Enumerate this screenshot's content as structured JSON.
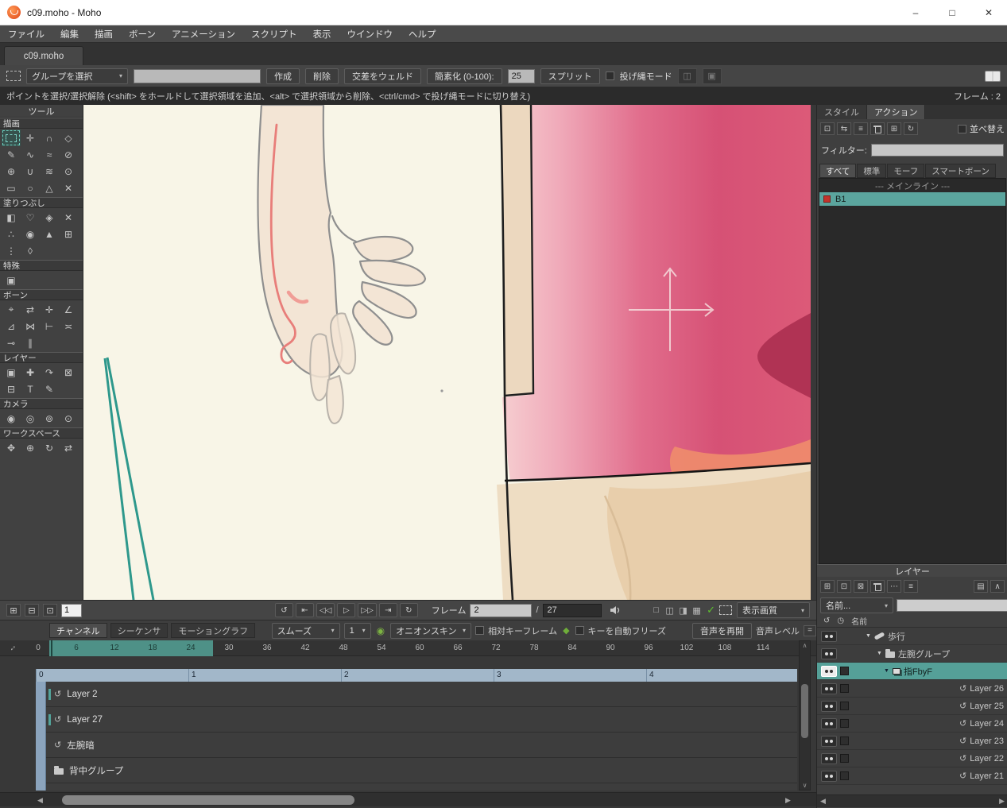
{
  "window": {
    "title": "c09.moho - Moho",
    "minimize": "–",
    "maximize": "□",
    "close": "✕"
  },
  "menu": {
    "items": [
      "ファイル",
      "編集",
      "描画",
      "ボーン",
      "アニメーション",
      "スクリプト",
      "表示",
      "ウインドウ",
      "ヘルプ"
    ]
  },
  "doc_tab": {
    "label": "c09.moho"
  },
  "toolbar": {
    "group_select": {
      "label": "グループを選択"
    },
    "search_value": "",
    "create": "作成",
    "delete": "削除",
    "weld": "交差をウェルド",
    "simplify": "簡素化 (0-100):",
    "simplify_value": "25",
    "split": "スプリット",
    "lasso": "投げ縄モード"
  },
  "hint": {
    "text": "ポイントを選択/選択解除 (<shift> をホールドして選択領域を追加、<alt> で選択領域から削除、<ctrl/cmd> で投げ縄モードに切り替え)",
    "frame": "フレーム : 2"
  },
  "tool_panel": {
    "title": "ツール",
    "draw": {
      "label": "描画",
      "tools": [
        {
          "name": "select-points",
          "marquee": true,
          "selected": true
        },
        {
          "name": "translate-points",
          "glyph": "✛"
        },
        {
          "name": "magnet",
          "glyph": "∩"
        },
        {
          "name": "perspective-points",
          "glyph": "◇"
        },
        {
          "name": "add-point",
          "glyph": "✎"
        },
        {
          "name": "freehand",
          "glyph": "∿"
        },
        {
          "name": "blob-brush",
          "glyph": "≈"
        },
        {
          "name": "delete-edge",
          "glyph": "⊘"
        },
        {
          "name": "draw-shape",
          "glyph": "⊕"
        },
        {
          "name": "curvature",
          "glyph": "∪"
        },
        {
          "name": "noise",
          "glyph": "≋"
        },
        {
          "name": "magnet-radius",
          "glyph": "⊙"
        },
        {
          "name": "rectangle",
          "glyph": "▭"
        },
        {
          "name": "oval",
          "glyph": "○"
        },
        {
          "name": "triangle",
          "glyph": "△"
        },
        {
          "name": "eraser",
          "glyph": "✕"
        }
      ]
    },
    "fill": {
      "label": "塗りつぶし",
      "tools": [
        {
          "name": "select-shape",
          "glyph": "◧"
        },
        {
          "name": "create-shape",
          "glyph": "♡"
        },
        {
          "name": "paint-bucket",
          "glyph": "◈"
        },
        {
          "name": "delete-shape",
          "glyph": "✕"
        },
        {
          "name": "stroke-exposure",
          "glyph": "∴"
        },
        {
          "name": "eyedropper",
          "glyph": "◉"
        },
        {
          "name": "line-width",
          "glyph": "▲"
        },
        {
          "name": "hide-edge",
          "glyph": "⊞"
        },
        {
          "name": "curve-profile",
          "glyph": "⋮"
        },
        {
          "name": "stroke-width",
          "glyph": "◊"
        }
      ]
    },
    "special": {
      "label": "特殊",
      "tools": [
        {
          "name": "insert-text",
          "glyph": "▣"
        }
      ]
    },
    "bone": {
      "label": "ボーン",
      "tools": [
        {
          "name": "select-bone",
          "glyph": "⌖"
        },
        {
          "name": "translate-bone",
          "glyph": "⇄"
        },
        {
          "name": "add-bone",
          "glyph": "✛"
        },
        {
          "name": "rotate-bone",
          "glyph": "∠"
        },
        {
          "name": "scale-bone",
          "glyph": "⊿"
        },
        {
          "name": "reparent-bone",
          "glyph": "⋈"
        },
        {
          "name": "bone-strength",
          "glyph": "⊢"
        },
        {
          "name": "bind-points",
          "glyph": "≍"
        },
        {
          "name": "bind-layer",
          "glyph": "⊸"
        },
        {
          "name": "manipulate-bones",
          "glyph": "∥"
        }
      ]
    },
    "layer": {
      "label": "レイヤー",
      "tools": [
        {
          "name": "transform-layer",
          "glyph": "▣"
        },
        {
          "name": "add-layer",
          "glyph": "✚"
        },
        {
          "name": "follow-path",
          "glyph": "↷"
        },
        {
          "name": "rotate-layer",
          "glyph": "⊠"
        },
        {
          "name": "shear-layer",
          "glyph": "⊟"
        },
        {
          "name": "text-tool",
          "glyph": "T"
        },
        {
          "name": "note-tool",
          "glyph": "✎"
        }
      ]
    },
    "camera": {
      "label": "カメラ",
      "tools": [
        {
          "name": "track-camera",
          "glyph": "◉"
        },
        {
          "name": "zoom-camera",
          "glyph": "◎"
        },
        {
          "name": "roll-camera",
          "glyph": "⊚"
        },
        {
          "name": "pan-tilt-camera",
          "glyph": "⊙"
        }
      ]
    },
    "workspace": {
      "label": "ワークスペース",
      "tools": [
        {
          "name": "pan-workspace",
          "glyph": "✥"
        },
        {
          "name": "zoom-workspace",
          "glyph": "⊕"
        },
        {
          "name": "rotate-workspace",
          "glyph": "↻"
        },
        {
          "name": "orbit-workspace",
          "glyph": "⇄"
        }
      ]
    }
  },
  "canvas": {
    "background": "#f8f5e7",
    "accent_teal": "#2e988c",
    "pink_deep": "#d65175",
    "pink_light": "#f6cdd0",
    "skin": "#ecd8bf",
    "sketch_gray": "#8f8f8f",
    "sketch_red": "#e87e7a",
    "outline": "#1f1f1f"
  },
  "transport": {
    "left_icons": [
      {
        "name": "add-keyframe",
        "glyph": "⊞"
      },
      {
        "name": "remove-keyframe",
        "glyph": "⊟"
      },
      {
        "name": "copy-keyframe",
        "glyph": "⊡"
      }
    ],
    "step_value": "1",
    "playback": [
      {
        "name": "rewind",
        "glyph": "↺"
      },
      {
        "name": "jump-start",
        "glyph": "⇤"
      },
      {
        "name": "step-back",
        "glyph": "◁◁"
      },
      {
        "name": "play",
        "glyph": "▷"
      },
      {
        "name": "step-forward",
        "glyph": "▷▷"
      },
      {
        "name": "jump-end",
        "glyph": "⇥"
      },
      {
        "name": "loop",
        "glyph": "↻"
      }
    ],
    "frame_label": "フレーム",
    "frame_value": "2",
    "separator": "/",
    "total_frames": "27",
    "view_modes": [
      {
        "name": "view-single",
        "glyph": "□"
      },
      {
        "name": "view-split-v",
        "glyph": "◫"
      },
      {
        "name": "view-split-h",
        "glyph": "◨"
      },
      {
        "name": "view-quad",
        "glyph": "▦"
      }
    ],
    "quality": {
      "label": "表示画質"
    }
  },
  "timeline": {
    "tabs": [
      {
        "label": "チャンネル",
        "active": true
      },
      {
        "label": "シーケンサ"
      },
      {
        "label": "モーショングラフ"
      }
    ],
    "smooth": {
      "label": "スムーズ"
    },
    "step": {
      "label": "1"
    },
    "onion": {
      "label": "オニオンスキン"
    },
    "relative_keys": {
      "label": "相対キーフレーム"
    },
    "auto_freeze": {
      "label": "キーを自動フリーズ"
    },
    "resume_audio": {
      "label": "音声を再開"
    },
    "audio_level": {
      "label": "音声レベル",
      "value": "="
    },
    "ruler": {
      "frames": [
        {
          "n": "0"
        },
        {
          "n": "6",
          "dark": true
        },
        {
          "n": "12",
          "dark": true
        },
        {
          "n": "18",
          "dark": true
        },
        {
          "n": "24",
          "dark": true
        },
        {
          "n": "30"
        },
        {
          "n": "36"
        },
        {
          "n": "42"
        },
        {
          "n": "48"
        },
        {
          "n": "54"
        },
        {
          "n": "60"
        },
        {
          "n": "66"
        },
        {
          "n": "72"
        },
        {
          "n": "78"
        },
        {
          "n": "84"
        },
        {
          "n": "90"
        },
        {
          "n": "96"
        },
        {
          "n": "102"
        },
        {
          "n": "108"
        },
        {
          "n": "114"
        }
      ]
    },
    "seconds": [
      "0",
      "1",
      "2",
      "3",
      "4"
    ],
    "tracks": [
      {
        "name": "Layer 2",
        "lasso": true,
        "mark": true
      },
      {
        "name": "Layer 27",
        "lasso": true,
        "mark": true
      },
      {
        "name": "左腕暗",
        "lasso": true
      },
      {
        "name": "背中グループ",
        "folder": true
      }
    ]
  },
  "actions_panel": {
    "tabs": [
      {
        "label": "スタイル"
      },
      {
        "label": "アクション",
        "active": true
      }
    ],
    "toolbar_icons": [
      {
        "name": "new-action",
        "glyph": "⊡"
      },
      {
        "name": "swap-action",
        "glyph": "⇆"
      },
      {
        "name": "action-list",
        "glyph": "≡"
      },
      {
        "name": "delete-action",
        "trash": true
      },
      {
        "name": "insert-copy-action",
        "glyph": "⊞"
      },
      {
        "name": "refresh-action",
        "glyph": "↻"
      }
    ],
    "sort_label": "並べ替え",
    "filter_label": "フィルター:",
    "filter_value": "",
    "filter_tabs": [
      {
        "label": "すべて",
        "active": true
      },
      {
        "label": "標準"
      },
      {
        "label": "モーフ"
      },
      {
        "label": "スマートボーン"
      }
    ],
    "list": [
      {
        "label": "--- メインライン ---",
        "header": true
      },
      {
        "label": "B1",
        "selected": true,
        "bone_badge": true
      }
    ]
  },
  "layers_panel": {
    "title": "レイヤー",
    "toolbar_icons": [
      {
        "name": "new-layer",
        "glyph": "⊞"
      },
      {
        "name": "duplicate-layer",
        "glyph": "⊡"
      },
      {
        "name": "reference-layer",
        "glyph": "⊠"
      },
      {
        "name": "delete-layer",
        "trash": true
      },
      {
        "name": "more-options",
        "glyph": "⋯"
      },
      {
        "name": "layer-settings",
        "glyph": "≡"
      },
      {
        "name": "layer-comps",
        "glyph": "▤",
        "right": true
      },
      {
        "name": "collapse-panel",
        "glyph": "∧"
      }
    ],
    "name_filter": {
      "label": "名前...",
      "value": ""
    },
    "columns": {
      "name": "名前"
    },
    "rows": [
      {
        "name": "歩行",
        "expander": true,
        "bone": true,
        "ind1": true
      },
      {
        "name": "左腕グループ",
        "expander": true,
        "folder": true,
        "ind2": true
      },
      {
        "name": "指FbyF",
        "expander": true,
        "frames": true,
        "ind3": true,
        "selected": true,
        "checkbox": true
      },
      {
        "name": "Layer 26",
        "lasso": true,
        "checkbox": true,
        "right": true
      },
      {
        "name": "Layer 25",
        "lasso": true,
        "checkbox": true,
        "right": true
      },
      {
        "name": "Layer 24",
        "lasso": true,
        "checkbox": true,
        "right": true
      },
      {
        "name": "Layer 23",
        "lasso": true,
        "checkbox": true,
        "right": true
      },
      {
        "name": "Layer 22",
        "lasso": true,
        "checkbox": true,
        "right": true
      },
      {
        "name": "Layer 21",
        "lasso": true,
        "checkbox": true,
        "right": true
      }
    ]
  },
  "icons": {
    "dropdown": "▾",
    "expander": "▼",
    "check": "✓",
    "onion": "◉",
    "shield": "◆",
    "left": "◀",
    "right": "▶",
    "up": "∧",
    "down": "∨",
    "resize": "↔",
    "cycle": "↺",
    "clock": "◷"
  }
}
